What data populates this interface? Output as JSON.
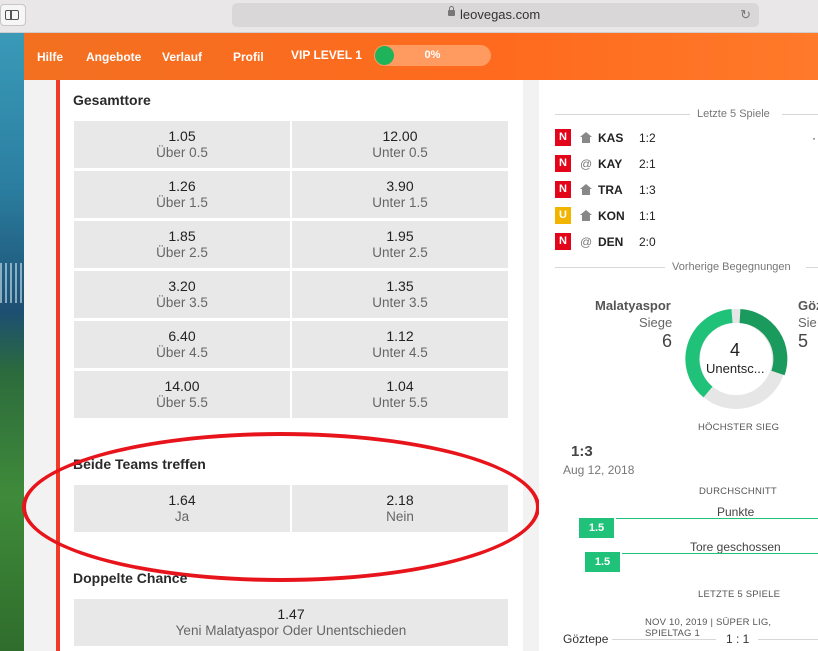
{
  "browser": {
    "url": "leovegas.com"
  },
  "nav": {
    "items": [
      "Hilfe",
      "Angebote",
      "Verlauf",
      "Profil"
    ],
    "vip_label": "VIP LEVEL 1",
    "vip_progress_text": "0%",
    "vip_progress": 0
  },
  "markets": {
    "total_goals": {
      "title": "Gesamttore",
      "rows": [
        [
          {
            "odds": "1.05",
            "label": "Über 0.5"
          },
          {
            "odds": "12.00",
            "label": "Unter 0.5"
          }
        ],
        [
          {
            "odds": "1.26",
            "label": "Über 1.5"
          },
          {
            "odds": "3.90",
            "label": "Unter 1.5"
          }
        ],
        [
          {
            "odds": "1.85",
            "label": "Über 2.5"
          },
          {
            "odds": "1.95",
            "label": "Unter 2.5"
          }
        ],
        [
          {
            "odds": "3.20",
            "label": "Über 3.5"
          },
          {
            "odds": "1.35",
            "label": "Unter 3.5"
          }
        ],
        [
          {
            "odds": "6.40",
            "label": "Über 4.5"
          },
          {
            "odds": "1.12",
            "label": "Unter 4.5"
          }
        ],
        [
          {
            "odds": "14.00",
            "label": "Über 5.5"
          },
          {
            "odds": "1.04",
            "label": "Unter 5.5"
          }
        ]
      ]
    },
    "both_teams": {
      "title": "Beide Teams treffen",
      "options": [
        {
          "odds": "1.64",
          "label": "Ja"
        },
        {
          "odds": "2.18",
          "label": "Nein"
        }
      ]
    },
    "double_chance": {
      "title": "Doppelte Chance",
      "options": [
        {
          "odds": "1.47",
          "label": "Yeni Malatyaspor Oder Unentschieden"
        }
      ]
    }
  },
  "stats": {
    "last5_title": "Letzte 5 Spiele",
    "last5": [
      {
        "result": "N",
        "venue": "home",
        "team": "KAS",
        "score": "1:2"
      },
      {
        "result": "N",
        "venue": "@",
        "team": "KAY",
        "score": "2:1"
      },
      {
        "result": "N",
        "venue": "home",
        "team": "TRA",
        "score": "1:3"
      },
      {
        "result": "U",
        "venue": "home",
        "team": "KON",
        "score": "1:1"
      },
      {
        "result": "N",
        "venue": "@",
        "team": "DEN",
        "score": "2:0"
      }
    ],
    "h2h_title": "Vorherige Begegnungen",
    "home_team": "Malatyaspor",
    "home_wins_label": "Siege",
    "home_wins": "6",
    "away_team": "Göz",
    "away_wins_label": "Sie",
    "away_wins": "5",
    "draws": "4",
    "draws_label": "Unentsc...",
    "highest_win_title": "HÖCHSTER SIEG",
    "highest_win_score": "1:3",
    "highest_win_date": "Aug 12, 2018",
    "average_title": "DURCHSCHNITT",
    "points_label": "Punkte",
    "points_value": "1.5",
    "goals_label": "Tore geschossen",
    "goals_value": "1.5",
    "last5_matches_title": "LETZTE 5 SPIELE",
    "match_info": "NOV 10, 2019 | SÜPER LIG, SPIELTAG 1",
    "match_team": "Göztepe",
    "match_score": "1 : 1",
    "colors": {
      "green": "#20c27a",
      "loss_red": "#e3061a",
      "draw_yellow": "#f3b400",
      "brand_orange": "#ff6a1e"
    }
  }
}
